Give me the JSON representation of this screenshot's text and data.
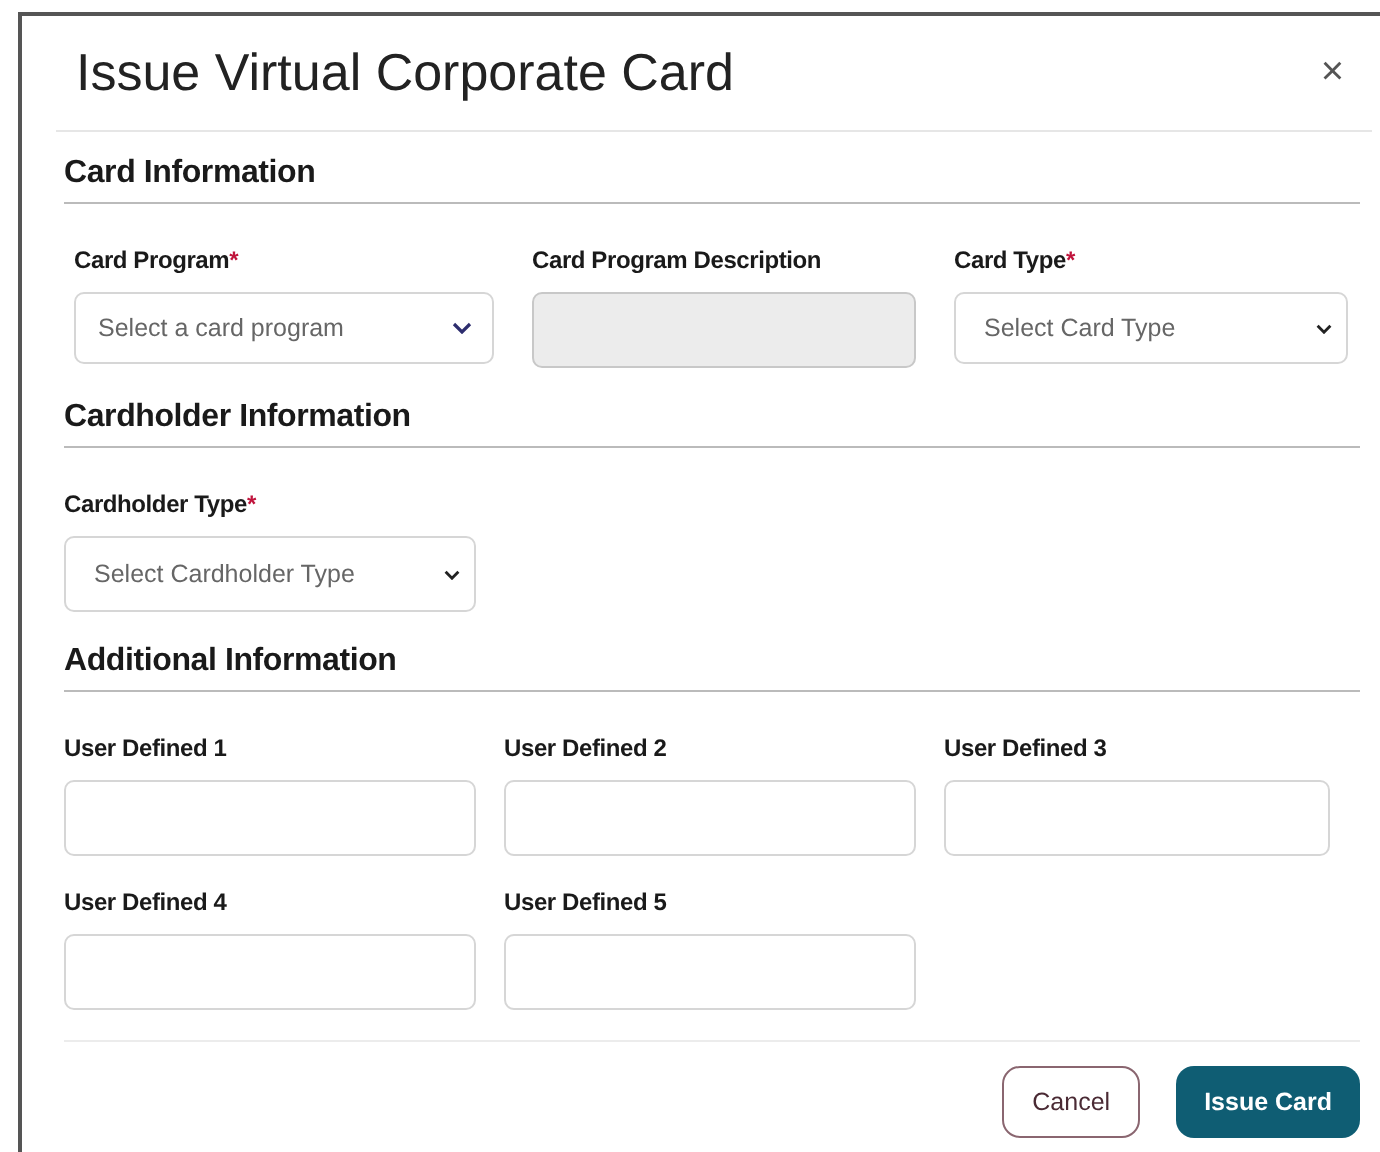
{
  "dialog": {
    "title": "Issue Virtual Corporate Card",
    "close": "×",
    "sections": [
      {
        "heading": "Card Information",
        "fields": [
          {
            "kind": "dropdown",
            "label": "Card Program",
            "required_mark": "*",
            "placeholder": "Select a card program"
          },
          {
            "kind": "readonly",
            "label": "Card Program Description"
          },
          {
            "kind": "select",
            "label": "Card Type",
            "required_mark": "*",
            "placeholder": "Select Card Type"
          }
        ]
      },
      {
        "heading": "Cardholder Information",
        "fields": [
          {
            "kind": "select",
            "label": "Cardholder Type",
            "required_mark": "*",
            "placeholder": "Select Cardholder Type"
          }
        ]
      },
      {
        "heading": "Additional Information",
        "fields": [
          {
            "kind": "text",
            "label": "User Defined 1"
          },
          {
            "kind": "text",
            "label": "User Defined 2"
          },
          {
            "kind": "text",
            "label": "User Defined 3"
          },
          {
            "kind": "text",
            "label": "User Defined 4"
          },
          {
            "kind": "text",
            "label": "User Defined 5"
          }
        ]
      }
    ],
    "buttons": [
      {
        "kind": "secondary",
        "label": "Cancel"
      },
      {
        "kind": "primary",
        "label": "Issue Card"
      }
    ]
  }
}
